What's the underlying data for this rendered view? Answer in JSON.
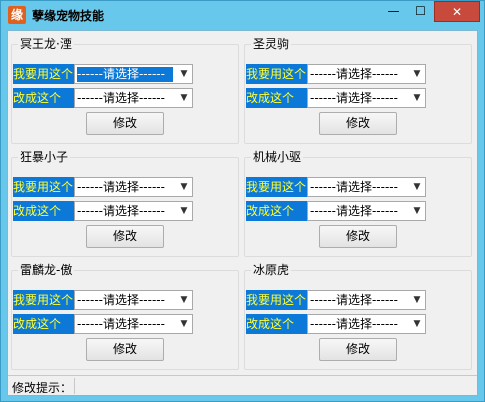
{
  "window": {
    "icon_glyph": "缘",
    "title": "孽缘宠物技能",
    "minimize_glyph": "—",
    "maximize_glyph": "☐",
    "close_glyph": "✕"
  },
  "groups": [
    {
      "title": "冥王龙·湮",
      "row1_label": "我要用这个",
      "row1_value": "------请选择------",
      "row2_label": "改成这个",
      "row2_value": "------请选择------",
      "button_label": "修改"
    },
    {
      "title": "圣灵驹",
      "row1_label": "我要用这个",
      "row1_value": "------请选择------",
      "row2_label": "改成这个",
      "row2_value": "------请选择------",
      "button_label": "修改"
    },
    {
      "title": "狂暴小子",
      "row1_label": "我要用这个",
      "row1_value": "------请选择------",
      "row2_label": "改成这个",
      "row2_value": "------请选择------",
      "button_label": "修改"
    },
    {
      "title": "机械小驱",
      "row1_label": "我要用这个",
      "row1_value": "------请选择------",
      "row2_label": "改成这个",
      "row2_value": "------请选择------",
      "button_label": "修改"
    },
    {
      "title": "雷麟龙-傲",
      "row1_label": "我要用这个",
      "row1_value": "------请选择------",
      "row2_label": "改成这个",
      "row2_value": "------请选择------",
      "button_label": "修改"
    },
    {
      "title": "冰原虎",
      "row1_label": "我要用这个",
      "row1_value": "------请选择------",
      "row2_label": "改成这个",
      "row2_value": "------请选择------",
      "button_label": "修改"
    }
  ],
  "combo_arrow": "▼",
  "status": {
    "label": "修改提示："
  },
  "colors": {
    "title_bg": "#68c8eb",
    "label_bg": "#0c78d7",
    "label_text": "#ffff33",
    "close_bg": "#c74a3c"
  }
}
